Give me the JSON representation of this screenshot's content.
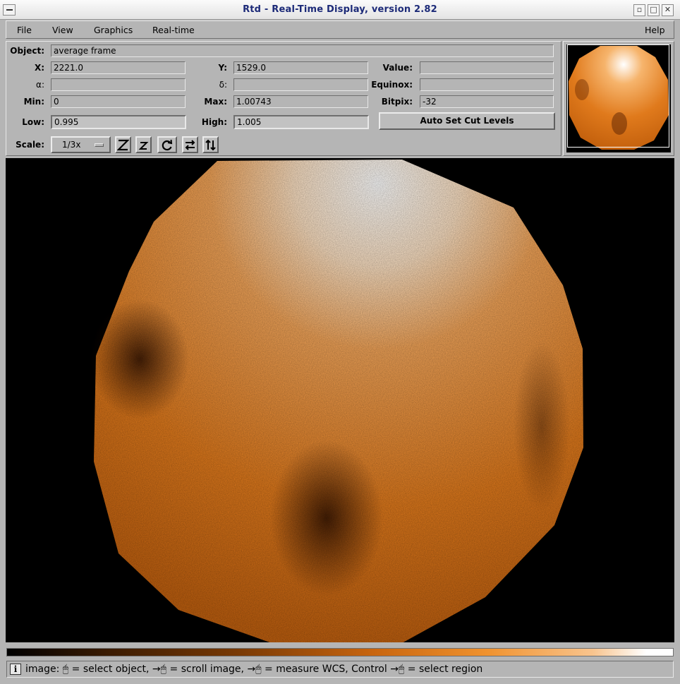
{
  "window": {
    "title": "Rtd - Real-Time Display, version 2.82"
  },
  "menu": {
    "file": "File",
    "view": "View",
    "graphics": "Graphics",
    "realtime": "Real-time",
    "help": "Help"
  },
  "info": {
    "object_label": "Object:",
    "object_value": "average frame",
    "x_label": "X:",
    "x_value": "2221.0",
    "y_label": "Y:",
    "y_value": "1529.0",
    "value_label": "Value:",
    "value_value": "",
    "alpha_label": "α:",
    "alpha_value": "",
    "delta_label": "δ:",
    "delta_value": "",
    "equinox_label": "Equinox:",
    "equinox_value": "",
    "min_label": "Min:",
    "min_value": "0",
    "max_label": "Max:",
    "max_value": "1.00743",
    "bitpix_label": "Bitpix:",
    "bitpix_value": "-32",
    "low_label": "Low:",
    "low_value": "0.995",
    "high_label": "High:",
    "high_value": "1.005",
    "auto_cut_button": "Auto Set Cut Levels",
    "scale_label": "Scale:",
    "scale_value": "1/3x"
  },
  "toolbar": {
    "zoom_in_label": "Z",
    "zoom_out_label": "z"
  },
  "colors": {
    "accent": "#e07a1c",
    "background": "#b5b5b5",
    "title_text": "#1c2a78"
  },
  "status": {
    "prefix": "image:",
    "part1": "= select object,",
    "part2": "= scroll image,",
    "part3": "= measure WCS, Control",
    "part4": "= select region"
  }
}
